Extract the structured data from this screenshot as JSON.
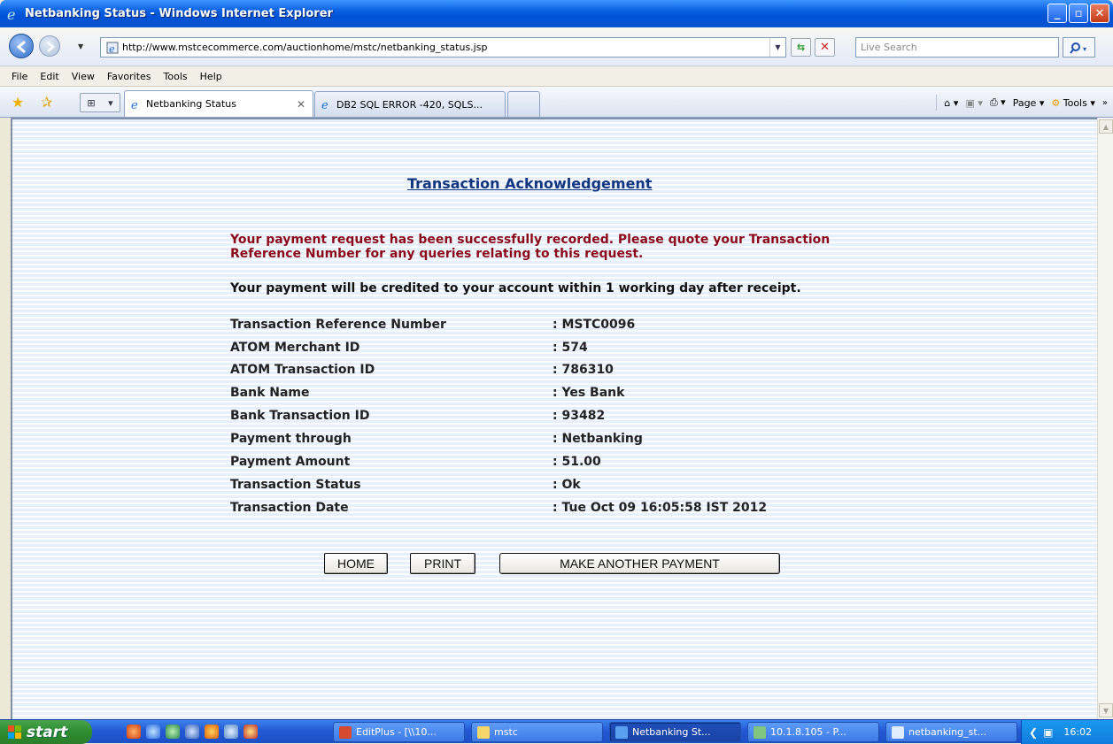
{
  "window": {
    "title": "Netbanking Status - Windows Internet Explorer",
    "controls": [
      "_",
      "▫",
      "✕"
    ]
  },
  "address_bar": {
    "url": "http://www.mstcecommerce.com/auctionhome/mstc/netbanking_status.jsp",
    "search_placeholder": "Live Search"
  },
  "menu": [
    "File",
    "Edit",
    "View",
    "Favorites",
    "Tools",
    "Help"
  ],
  "tabs": [
    {
      "label": "Netbanking Status",
      "active": true
    },
    {
      "label": "DB2 SQL ERROR -420, SQLS...",
      "active": false
    }
  ],
  "command_bar": {
    "page_label": "Page",
    "tools_label": "Tools"
  },
  "page": {
    "heading": "Transaction Acknowledgement",
    "message_red": "Your payment request has been successfully recorded. Please quote your Transaction Reference Number for any queries relating to this request.",
    "message_black": "Your payment will be credited to your account within 1 working day after receipt.",
    "details": [
      {
        "label": "Transaction Reference Number",
        "value": ": MSTC0096"
      },
      {
        "label": "ATOM Merchant ID",
        "value": ": 574"
      },
      {
        "label": "ATOM Transaction ID",
        "value": ": 786310"
      },
      {
        "label": "Bank Name",
        "value": ": Yes Bank"
      },
      {
        "label": "Bank Transaction ID",
        "value": ": 93482"
      },
      {
        "label": "Payment through",
        "value": ": Netbanking"
      },
      {
        "label": "Payment Amount",
        "value": ": 51.00"
      },
      {
        "label": "Transaction Status",
        "value": ": Ok"
      },
      {
        "label": "Transaction Date",
        "value": ": Tue Oct 09 16:05:58 IST 2012"
      }
    ],
    "buttons": {
      "home": "HOME",
      "print": "PRINT",
      "another": "MAKE ANOTHER PAYMENT"
    }
  },
  "taskbar": {
    "start_label": "start",
    "tasks": [
      {
        "label": "EditPlus - [\\\\10...",
        "active": false
      },
      {
        "label": "mstc",
        "active": false
      },
      {
        "label": "Netbanking St...",
        "active": true
      },
      {
        "label": "10.1.8.105 - P...",
        "active": false
      },
      {
        "label": "netbanking_st...",
        "active": false
      }
    ],
    "clock": "16:02"
  },
  "colors": {
    "heading": "#12357f",
    "message_red": "#8b0a1a",
    "taskbar": "#2459d4",
    "start": "#2e8c2f"
  }
}
